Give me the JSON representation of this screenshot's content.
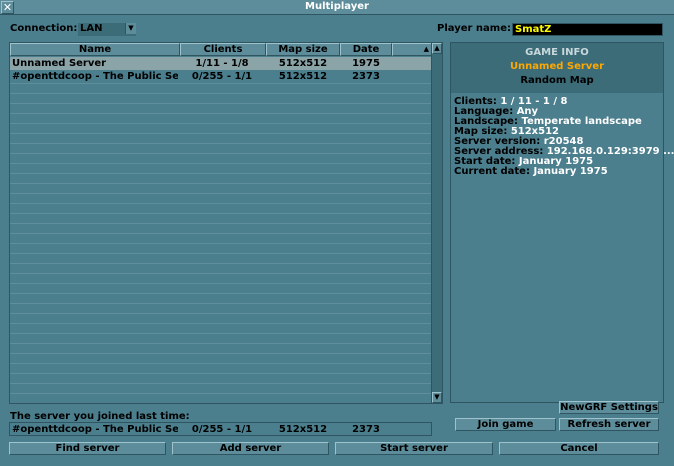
{
  "window": {
    "title": "Multiplayer"
  },
  "connection": {
    "label": "Connection:",
    "value": "LAN"
  },
  "player": {
    "label": "Player name:",
    "value": "SmatZ"
  },
  "columns": {
    "name": "Name",
    "clients": "Clients",
    "map_size": "Map size",
    "date": "Date"
  },
  "servers": [
    {
      "name": "Unnamed Server",
      "clients": "1/11 - 1/8",
      "map_size": "512x512",
      "date": "1975",
      "status_color": "#3c9c3c",
      "flag_color": "#6ec2e6",
      "locked": false
    },
    {
      "name": "#openttdcoop - The Public Se...",
      "clients": "0/255 - 1/1",
      "map_size": "512x512",
      "date": "2373",
      "status_color": "#d01818",
      "flag_color": "#d01818",
      "locked": true
    }
  ],
  "game_info": {
    "header": "GAME INFO",
    "server_name": "Unnamed Server",
    "map_type": "Random Map",
    "details": [
      {
        "label": "Clients: ",
        "value": "1 / 11 - 1 / 8"
      },
      {
        "label": "Language: ",
        "value": "Any"
      },
      {
        "label": "Landscape: ",
        "value": "Temperate landscape"
      },
      {
        "label": "Map size: ",
        "value": "512x512"
      },
      {
        "label": "Server version: ",
        "value": "r20548"
      },
      {
        "label": "Server address: ",
        "value": "192.168.0.129:3979 ..."
      },
      {
        "label": "Start date: ",
        "value": "January 1975"
      },
      {
        "label": "Current date: ",
        "value": "January 1975"
      }
    ]
  },
  "last_joined": {
    "label": "The server you joined last time:",
    "name": "#openttdcoop - The Public Se...",
    "clients": "0/255 - 1/1",
    "map_size": "512x512",
    "date": "2373"
  },
  "buttons": {
    "newgrf": "NewGRF Settings",
    "join": "Join game",
    "refresh": "Refresh server",
    "find": "Find server",
    "add": "Add server",
    "start": "Start server",
    "cancel": "Cancel"
  },
  "colors": {
    "panel": "#4b7f8e",
    "button": "#5d8d9a",
    "server_name_highlight": "#fca800",
    "player_name_text": "#fcfc00"
  }
}
